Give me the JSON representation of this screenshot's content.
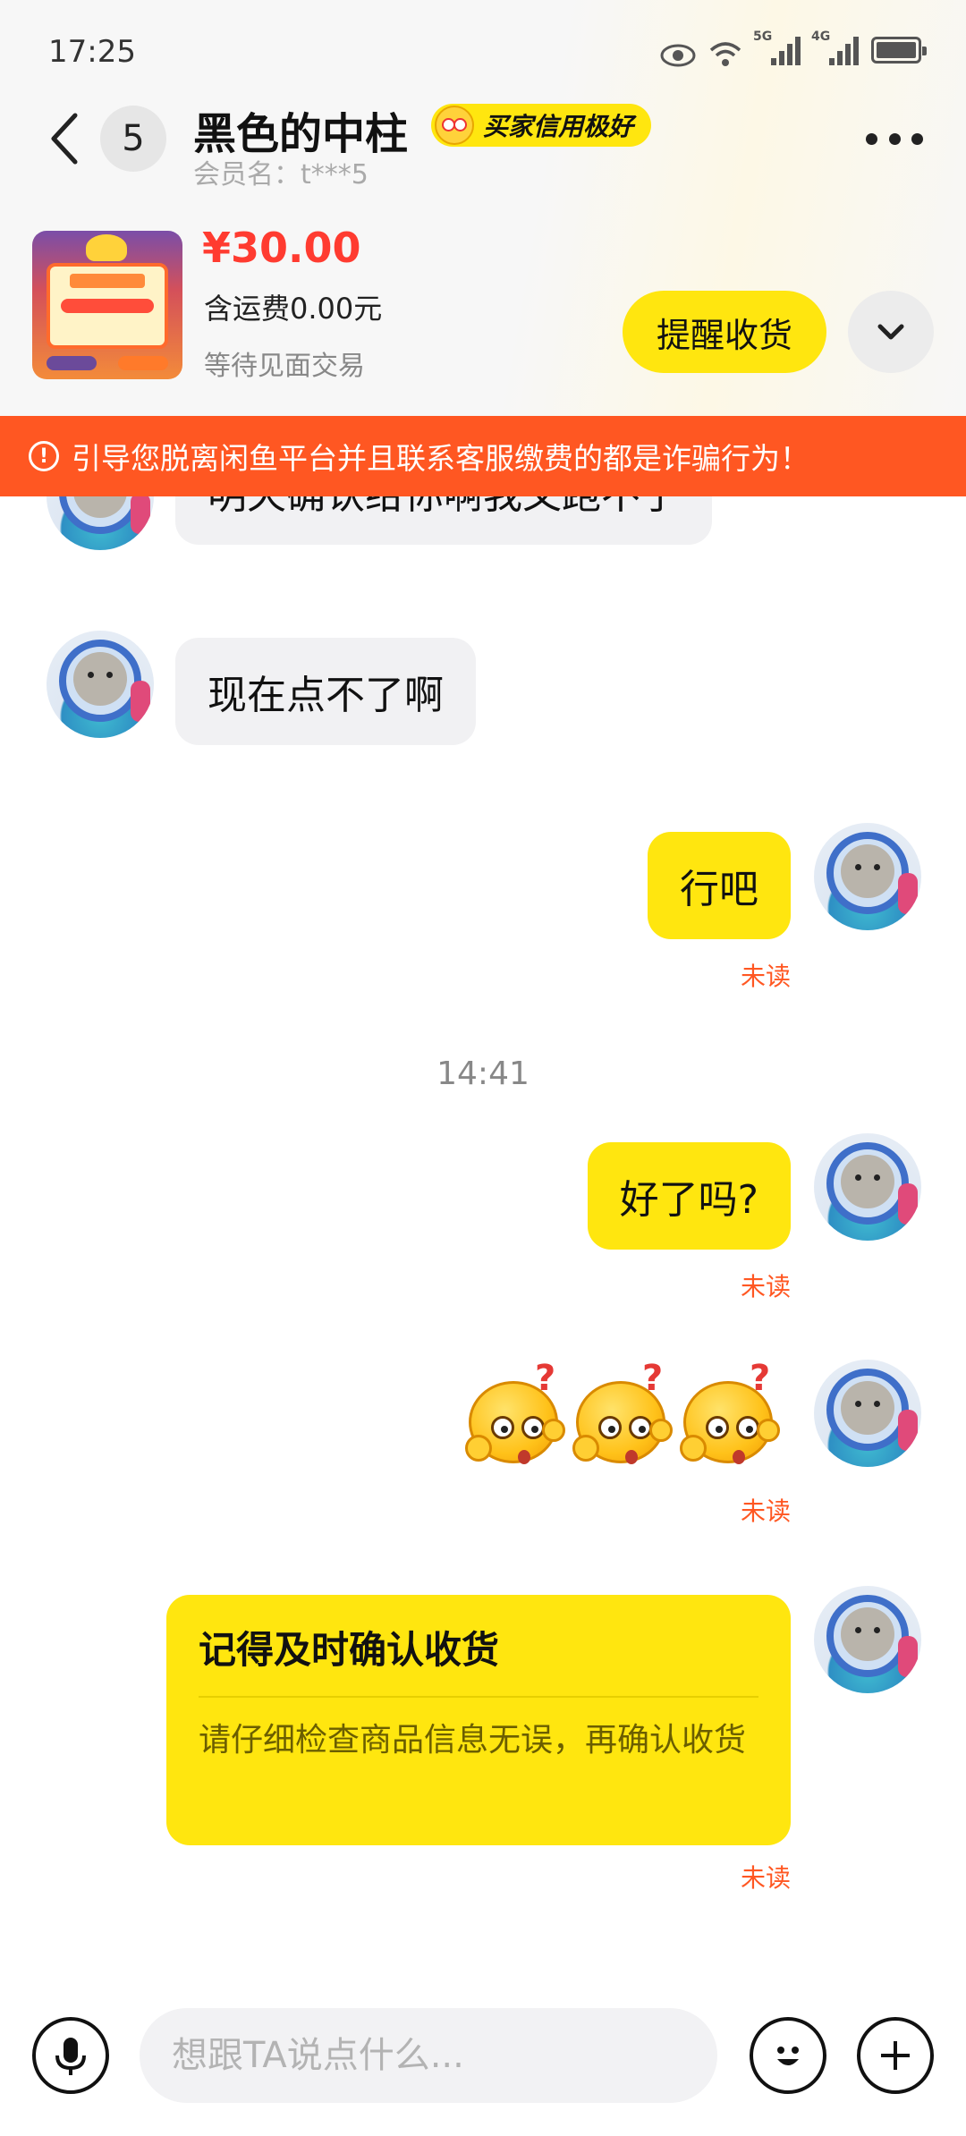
{
  "status_bar": {
    "time": "17:25",
    "network_1": "5G",
    "network_2": "4G"
  },
  "header": {
    "unread_count": "5",
    "contact_name": "黑色的中柱",
    "credit_badge": "买家信用极好",
    "member_name": "会员名：t***5"
  },
  "product": {
    "price": "¥30.00",
    "shipping": "含运费0.00元",
    "trade_status": "等待见面交易",
    "remind_button": "提醒收货"
  },
  "warning": {
    "text": "引导您脱离闲鱼平台并且联系客服缴费的都是诈骗行为！",
    "icon_glyph": "!"
  },
  "messages": {
    "partial_top": "明天确认给你啊我又跑不了",
    "incoming_1": "现在点不了啊",
    "outgoing_1": "行吧",
    "outgoing_1_status": "未读",
    "time_divider": "14:41",
    "outgoing_2": "好了吗?",
    "outgoing_2_status": "未读",
    "emoji_status": "未读",
    "card_title": "记得及时确认收货",
    "card_body": "请仔细检查商品信息无误，再确认收货",
    "card_status": "未读"
  },
  "input": {
    "placeholder": "想跟TA说点什么..."
  },
  "colors": {
    "accent_yellow": "#ffe60f",
    "warning_orange": "#ff5722",
    "price_red": "#ff3b30"
  },
  "icons": {
    "back": "chevron-left-icon",
    "more": "more-dots-icon",
    "expand": "chevron-down-icon",
    "voice": "microphone-icon",
    "emoji": "smiley-icon",
    "plus": "plus-icon"
  }
}
